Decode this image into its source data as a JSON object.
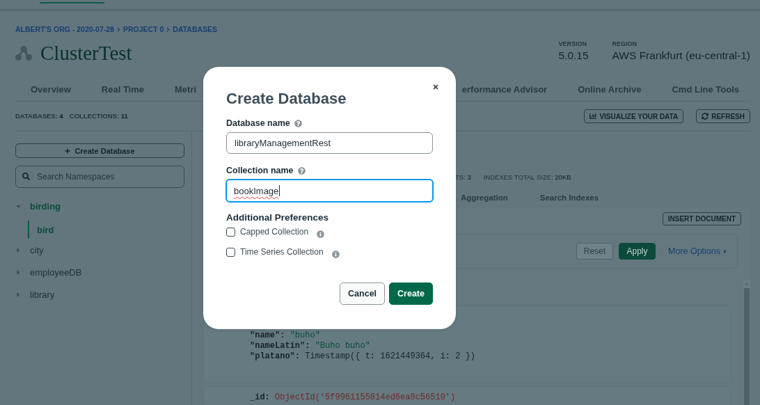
{
  "header": {
    "active_tab_indicator": true
  },
  "breadcrumb": [
    "ALBERT'S ORG - 2020-07-28",
    "PROJECT 0",
    "DATABASES"
  ],
  "cluster": {
    "name": "ClusterTest",
    "version_label": "VERSION",
    "version": "5.0.15",
    "region_label": "REGION",
    "region": "AWS Frankfurt (eu-central-1)"
  },
  "cluster_tabs": {
    "left": [
      {
        "label": "Overview",
        "selected": false
      },
      {
        "label": "Real Time",
        "selected": false
      },
      {
        "label": "Metri",
        "selected": false
      }
    ],
    "right": [
      {
        "label": "erformance Advisor",
        "selected": false
      },
      {
        "label": "Online Archive",
        "selected": false
      },
      {
        "label": "Cmd Line Tools",
        "selected": false
      }
    ]
  },
  "summary": [
    {
      "label": "DATABASES:",
      "value": "4"
    },
    {
      "label": "COLLECTIONS:",
      "value": "11"
    }
  ],
  "actions": [
    {
      "label": "VISUALIZE YOUR DATA",
      "kind": "chart"
    },
    {
      "label": "REFRESH",
      "kind": "refresh"
    }
  ],
  "sidebar": {
    "create_button": "Create Database",
    "search": {
      "placeholder": "Search Namespaces"
    },
    "tree": [
      {
        "label": "birding",
        "selected": true,
        "expanded": true,
        "children": [
          {
            "label": "bird",
            "selected": true
          }
        ]
      },
      {
        "label": "city",
        "selected": false,
        "expanded": false
      },
      {
        "label": "employeeDB",
        "selected": false,
        "expanded": false
      },
      {
        "label": "library",
        "selected": false,
        "expanded": false
      }
    ]
  },
  "collection": {
    "stats": [
      {
        "label": "TS:",
        "value": "3"
      },
      {
        "label": "INDEXES TOTAL SIZE:",
        "value": "20KB"
      }
    ],
    "tabs": [
      {
        "label": "Aggregation",
        "selected": false
      },
      {
        "label": "Search Indexes",
        "selected": false
      }
    ],
    "insert_button": "INSERT DOCUMENT",
    "filter": {
      "buttons": [
        {
          "label": "Reset",
          "kind": "reset",
          "disabled": true
        },
        {
          "label": "Apply",
          "kind": "apply",
          "disabled": false
        }
      ],
      "more_options": "More Options"
    },
    "documents": [
      {
        "fields": [
          {
            "key": "\"name\":",
            "value": "\"buho\"",
            "kind": "string"
          },
          {
            "key": "\"nameLatin\":",
            "value": "\"Buho buho\"",
            "kind": "string"
          },
          {
            "key": "\"platano\":",
            "value": "Timestamp({ t: 1621449364, i: 2 })",
            "kind": "plain"
          }
        ]
      },
      {
        "fields": [
          {
            "key": "_id:",
            "value": "ObjectId('5f9961155814ed6ea8c56510')",
            "kind": "objectid"
          }
        ]
      }
    ]
  },
  "dialog": {
    "title": "Create Database",
    "fields": [
      {
        "label": "Database name",
        "value": "libraryManagementRest",
        "focused": false,
        "spellcheck_error": false
      },
      {
        "label": "Collection name",
        "value": "bookImage",
        "focused": true,
        "spellcheck_error": true
      }
    ],
    "preferences_title": "Additional Preferences",
    "options": [
      {
        "label": "Capped Collection",
        "checked": false
      },
      {
        "label": "Time Series Collection",
        "checked": false
      }
    ],
    "buttons": [
      {
        "label": "Cancel",
        "kind": "secondary"
      },
      {
        "label": "Create",
        "kind": "primary"
      }
    ]
  }
}
